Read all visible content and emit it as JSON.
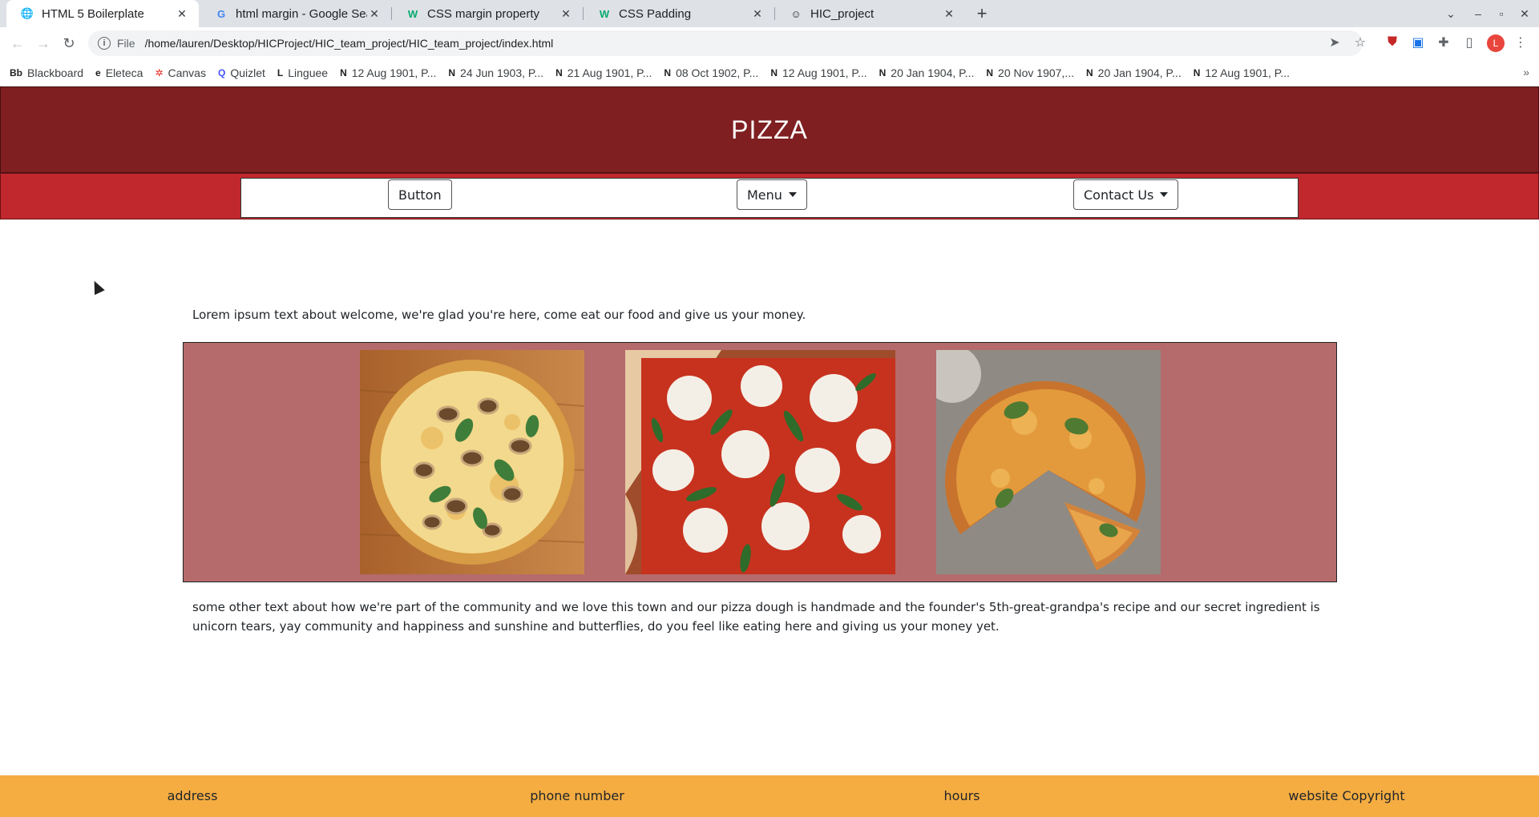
{
  "browser": {
    "tabs": [
      {
        "title": "HTML 5 Boilerplate",
        "icon": "globe-icon",
        "glyph": "🌐",
        "active": true
      },
      {
        "title": "html margin - Google Search",
        "icon": "google-icon",
        "glyph": "G",
        "active": false
      },
      {
        "title": "CSS margin property",
        "icon": "w3schools-icon",
        "glyph": "W",
        "active": false
      },
      {
        "title": "CSS Padding",
        "icon": "w3schools-icon",
        "glyph": "W",
        "active": false
      },
      {
        "title": "HIC_project",
        "icon": "smiley-icon",
        "glyph": "☺",
        "active": false
      }
    ],
    "address": {
      "scheme": "File",
      "url": "/home/lauren/Desktop/HICProject/HIC_team_project/HIC_team_project/index.html"
    },
    "profile_initial": "L",
    "bookmarks": [
      {
        "label": "Blackboard",
        "glyph": "Bb"
      },
      {
        "label": "Eleteca",
        "glyph": "e"
      },
      {
        "label": "Canvas",
        "glyph": "✲"
      },
      {
        "label": "Quizlet",
        "glyph": "Q"
      },
      {
        "label": "Linguee",
        "glyph": "L"
      },
      {
        "label": "12 Aug 1901, P...",
        "glyph": "N"
      },
      {
        "label": "24 Jun 1903, P...",
        "glyph": "N"
      },
      {
        "label": "21 Aug 1901, P...",
        "glyph": "N"
      },
      {
        "label": "08 Oct 1902, P...",
        "glyph": "N"
      },
      {
        "label": "12 Aug 1901, P...",
        "glyph": "N"
      },
      {
        "label": "20 Jan 1904, P...",
        "glyph": "N"
      },
      {
        "label": "20 Nov 1907,...",
        "glyph": "N"
      },
      {
        "label": "20 Jan 1904, P...",
        "glyph": "N"
      },
      {
        "label": "12 Aug 1901, P...",
        "glyph": "N"
      }
    ]
  },
  "site": {
    "title": "PIZZA",
    "nav": {
      "button": "Button",
      "menu": "Menu",
      "contact": "Contact Us"
    },
    "intro": "Lorem ipsum text about welcome, we're glad you're here, come eat our food and give us your money.",
    "story": "some other text about how we're part of the community and we love this town and our pizza dough is handmade and the founder's 5th-great-grandpa's recipe and our secret ingredient is unicorn tears, yay community and happiness and sunshine and butterflies, do you feel like eating here and giving us your money yet.",
    "footer": {
      "address": "address",
      "phone": "phone number",
      "hours": "hours",
      "copyright": "website Copyright"
    }
  },
  "colors": {
    "header": "#7f1f21",
    "nav": "#c1282e",
    "gallery": "#b56b6b",
    "footer": "#f5ad42"
  }
}
